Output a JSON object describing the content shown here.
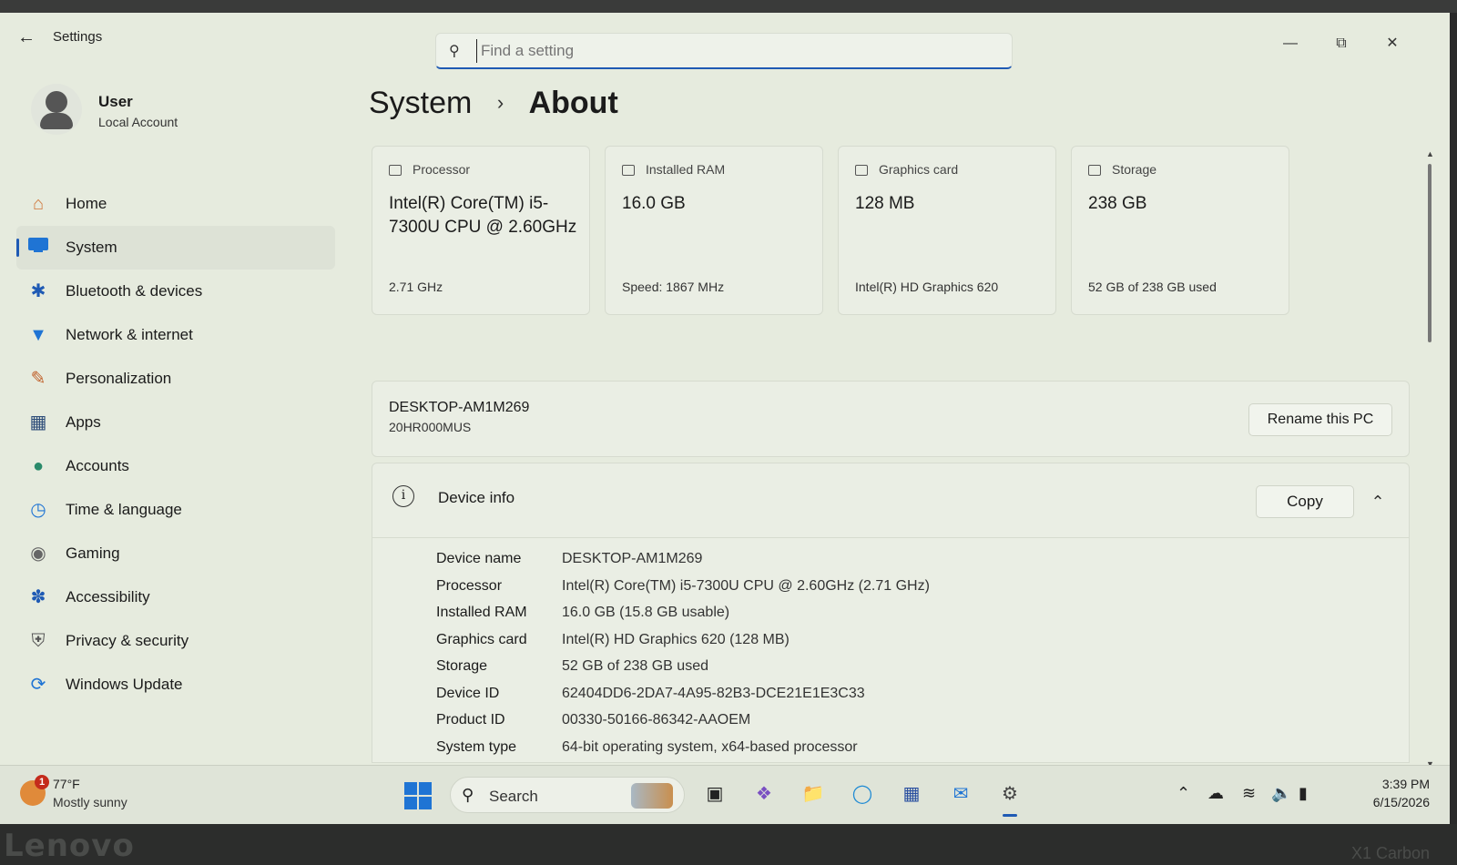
{
  "window": {
    "title": "Settings",
    "search_placeholder": "Find a setting"
  },
  "user": {
    "name": "User",
    "account_type": "Local Account"
  },
  "nav": [
    {
      "label": "Home",
      "icon": "home-icon"
    },
    {
      "label": "System",
      "icon": "system-icon",
      "active": true
    },
    {
      "label": "Bluetooth & devices",
      "icon": "bluetooth-icon"
    },
    {
      "label": "Network & internet",
      "icon": "wifi-icon"
    },
    {
      "label": "Personalization",
      "icon": "brush-icon"
    },
    {
      "label": "Apps",
      "icon": "apps-icon"
    },
    {
      "label": "Accounts",
      "icon": "account-icon"
    },
    {
      "label": "Time & language",
      "icon": "clock-globe-icon"
    },
    {
      "label": "Gaming",
      "icon": "gamepad-icon"
    },
    {
      "label": "Accessibility",
      "icon": "accessibility-icon"
    },
    {
      "label": "Privacy & security",
      "icon": "shield-icon"
    },
    {
      "label": "Windows Update",
      "icon": "update-icon"
    }
  ],
  "breadcrumb": {
    "parent": "System",
    "separator": "›",
    "current": "About"
  },
  "specs": [
    {
      "label": "Processor",
      "value": "Intel(R) Core(TM) i5-7300U CPU @ 2.60GHz",
      "sub": "2.71 GHz",
      "icon": "processor-icon"
    },
    {
      "label": "Installed RAM",
      "value": "16.0 GB",
      "sub": "Speed: 1867 MHz",
      "icon": "ram-icon"
    },
    {
      "label": "Graphics card",
      "value": "128 MB",
      "sub": "Intel(R) HD Graphics 620",
      "icon": "graphics-card-icon"
    },
    {
      "label": "Storage",
      "value": "238 GB",
      "sub": "52 GB of 238 GB used",
      "icon": "storage-icon"
    }
  ],
  "pc": {
    "name": "DESKTOP-AM1M269",
    "model": "20HR000MUS",
    "rename_label": "Rename this PC"
  },
  "device_info": {
    "title": "Device info",
    "copy_label": "Copy",
    "rows": [
      {
        "key": "Device name",
        "value": "DESKTOP-AM1M269"
      },
      {
        "key": "Processor",
        "value": "Intel(R) Core(TM) i5-7300U CPU @ 2.60GHz (2.71 GHz)"
      },
      {
        "key": "Installed RAM",
        "value": "16.0 GB (15.8 GB usable)"
      },
      {
        "key": "Graphics card",
        "value": "Intel(R) HD Graphics 620 (128 MB)"
      },
      {
        "key": "Storage",
        "value": "52 GB of 238 GB used"
      },
      {
        "key": "Device ID",
        "value": "62404DD6-2DA7-4A95-82B3-DCE21E1E3C33"
      },
      {
        "key": "Product ID",
        "value": "00330-50166-86342-AAOEM"
      },
      {
        "key": "System type",
        "value": "64-bit operating system, x64-based processor"
      }
    ]
  },
  "taskbar": {
    "weather_temp": "77°F",
    "weather_desc": "Mostly sunny",
    "weather_badge": "1",
    "search_label": "Search",
    "time": "3:39 PM",
    "date": "6/15/2026"
  },
  "bezel": {
    "brand": "Lenovo",
    "model": "X1 Carbon"
  },
  "colors": {
    "accent": "#1f5ab4",
    "background": "#e6ebde",
    "card": "#eaeee4"
  }
}
